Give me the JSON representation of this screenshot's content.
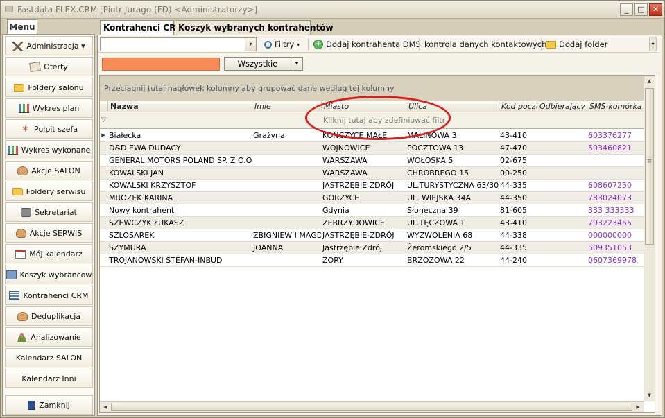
{
  "window": {
    "title": "Fastdata FLEX.CRM [Piotr Jurago (FD) <Administratorzy>]",
    "min_glyph": "_",
    "max_glyph": "□",
    "close_glyph": "✕"
  },
  "sidebar": {
    "tab_label": "Menu",
    "items": [
      {
        "label": "Administracja ▾",
        "icon": "tools-icon"
      },
      {
        "label": "Oferty",
        "icon": "offers-icon"
      },
      {
        "label": "Foldery salonu",
        "icon": "folder-icon"
      },
      {
        "label": "Wykres plan",
        "icon": "chart-icon"
      },
      {
        "label": "Pulpit szefa",
        "icon": "star-icon"
      },
      {
        "label": "Wykres wykonane",
        "icon": "chart-icon"
      },
      {
        "label": "Akcje SALON",
        "icon": "hand-icon"
      },
      {
        "label": "Foldery serwisu",
        "icon": "folder-icon"
      },
      {
        "label": "Sekretariat",
        "icon": "phone-icon"
      },
      {
        "label": "Akcje SERWIS",
        "icon": "hand-icon"
      },
      {
        "label": "Mój kalendarz",
        "icon": "calendar-icon"
      },
      {
        "label": "Koszyk wybrancow",
        "icon": "basket-icon"
      },
      {
        "label": "Kontrahenci CRM",
        "icon": "grid-icon"
      },
      {
        "label": "Deduplikacja",
        "icon": "hand-icon"
      },
      {
        "label": "Analizowanie",
        "icon": "person-icon"
      },
      {
        "label": "Kalendarz SALON",
        "icon": ""
      },
      {
        "label": "Kalendarz Inni",
        "icon": ""
      },
      {
        "label": "Zamknij",
        "icon": "exit-icon"
      }
    ]
  },
  "tabs": {
    "active": "Kontrahenci CRM",
    "inactive": "Koszyk wybranych kontrahentów"
  },
  "toolbar": {
    "search_value": "",
    "filters_label": "Filtry",
    "filters_glyph": "▾",
    "add_dms_label": "Dodaj kontrahenta DMS",
    "contact_check_label": "kontrola danych kontaktowych",
    "add_folder_label": "Dodaj folder",
    "combo_glyph": "▾",
    "overflow_glyph": "▾"
  },
  "filterbar": {
    "color_tag": "#f58b57",
    "dropdown_value": "Wszystkie",
    "dropdown_glyph": "▾"
  },
  "grid": {
    "group_hint": "Przeciągnij tutaj nagłówek kolumny aby grupować dane według tej kolumny",
    "filter_hint": "Kliknij tutaj aby zdefiniować filtr",
    "filter_glyph": "▽",
    "current_row_glyph": "▶",
    "columns": [
      "Nazwa",
      "Imie",
      "Miasto",
      "Ulica",
      "Kod poczto",
      "Odbierający",
      "SMS-komórka"
    ],
    "rows": [
      [
        "Białecka",
        "Grażyna",
        "KOŃCZYCE MAŁE",
        "MALINOWA 3",
        "43-410",
        "",
        "603376277"
      ],
      [
        "D&D EWA DUDACY",
        "",
        "WOJNOWICE",
        "POCZTOWA 13",
        "47-470",
        "",
        "503460821"
      ],
      [
        "GENERAL MOTORS POLAND SP. Z O.O.",
        "",
        "WARSZAWA",
        "WOŁOSKA 5",
        "02-675",
        "",
        ""
      ],
      [
        "KOWALSKI JAN",
        "",
        "WARSZAWA",
        "CHROBREGO 15",
        "00-250",
        "",
        ""
      ],
      [
        "KOWALSKI KRZYSZTOF",
        "",
        "JASTRZĘBIE ZDRÓJ",
        "UL.TURYSTYCZNA 63/30",
        "44-335",
        "",
        "608607250"
      ],
      [
        "MROZEK KARINA",
        "",
        "GORZYCE",
        "UL. WIEJSKA 34A",
        "44-350",
        "",
        "783024073"
      ],
      [
        "Nowy kontrahent",
        "",
        "Gdynia",
        "Słoneczna 39",
        "81-605",
        "",
        "333 333333"
      ],
      [
        "SZEWCZYK ŁUKASZ",
        "",
        "ZEBRZYDOWICE",
        "UL.TĘCZOWA 1",
        "43-410",
        "",
        "793223455"
      ],
      [
        "SZLOSAREK",
        "ZBIGNIEW I MAGDA",
        "JASTRZĘBIE-ZDRÓJ",
        "WYZWOLENIA 68",
        "44-338",
        "",
        "000000000"
      ],
      [
        "SZYMURA",
        "JOANNA",
        "Jastrzębie Zdrój",
        "Żeromskiego 2/5",
        "44-335",
        "",
        "509351053"
      ],
      [
        "TROJANOWSKI STEFAN-INBUD",
        "",
        "ŻORY",
        "BRZOZOWA 22",
        "44-240",
        "",
        "0607369978"
      ]
    ],
    "scroll_up_glyph": "▲",
    "scroll_down_glyph": "▼",
    "scroll_left_glyph": "◀",
    "scroll_right_glyph": "▶",
    "scroll_grip_glyph": "≡"
  }
}
